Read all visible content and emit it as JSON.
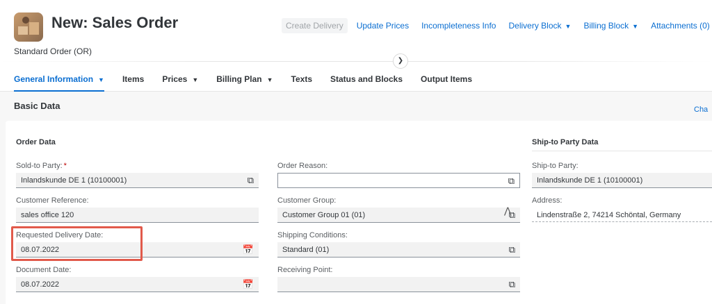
{
  "header": {
    "title": "New: Sales Order",
    "subtitle": "Standard Order (OR)",
    "actions": [
      {
        "label": "Create Delivery",
        "disabled": true,
        "has_menu": false
      },
      {
        "label": "Update Prices",
        "disabled": false,
        "has_menu": false
      },
      {
        "label": "Incompleteness Info",
        "disabled": false,
        "has_menu": false
      },
      {
        "label": "Delivery Block",
        "disabled": false,
        "has_menu": true
      },
      {
        "label": "Billing Block",
        "disabled": false,
        "has_menu": true
      },
      {
        "label": "Attachments (0)",
        "disabled": false,
        "has_menu": false
      }
    ],
    "expand_icon": "chevron-down-icon"
  },
  "tabs": [
    {
      "label": "General Information",
      "active": true,
      "has_menu": true
    },
    {
      "label": "Items",
      "active": false,
      "has_menu": false
    },
    {
      "label": "Prices",
      "active": false,
      "has_menu": true
    },
    {
      "label": "Billing Plan",
      "active": false,
      "has_menu": true
    },
    {
      "label": "Texts",
      "active": false,
      "has_menu": false
    },
    {
      "label": "Status and Blocks",
      "active": false,
      "has_menu": false
    },
    {
      "label": "Output Items",
      "active": false,
      "has_menu": false
    }
  ],
  "section": {
    "title": "Basic Data",
    "right_link": "Cha"
  },
  "order_data": {
    "title": "Order Data",
    "sold_to_label": "Sold-to Party:",
    "sold_to_required": "*",
    "sold_to_value": "Inlandskunde DE 1 (10100001)",
    "customer_ref_label": "Customer Reference:",
    "customer_ref_value": "sales office 120",
    "req_delivery_label": "Requested Delivery Date:",
    "req_delivery_value": "08.07.2022",
    "document_date_label": "Document Date:",
    "document_date_value": "08.07.2022"
  },
  "middle_column": {
    "order_reason_label": "Order Reason:",
    "order_reason_value": "",
    "customer_group_label": "Customer Group:",
    "customer_group_value": "Customer Group 01 (01)",
    "shipping_label": "Shipping Conditions:",
    "shipping_value": "Standard (01)",
    "receiving_label": "Receiving Point:",
    "receiving_value": ""
  },
  "ship_to": {
    "title": "Ship-to Party Data",
    "party_label": "Ship-to Party:",
    "party_value": "Inlandskunde DE 1 (10100001)",
    "address_label": "Address:",
    "address_value": "Lindenstraße 2, 74214 Schöntal, Germany"
  },
  "colors": {
    "accent": "#0a6ed1",
    "highlight": "#e15a4b",
    "required": "#bb0000"
  }
}
